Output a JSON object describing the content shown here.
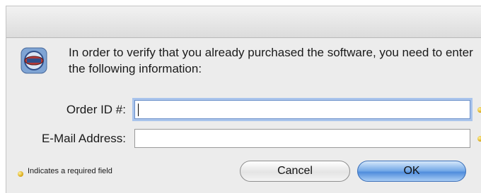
{
  "dialog": {
    "message": "In order to verify that you already purchased the software, you need to enter the following information:",
    "fields": {
      "order_id": {
        "label": "Order ID #:",
        "value": ""
      },
      "email": {
        "label": "E-Mail Address:",
        "value": ""
      }
    },
    "required_legend": "Indicates a required field",
    "buttons": {
      "cancel": "Cancel",
      "ok": "OK"
    }
  },
  "colors": {
    "default_button": "#5b95e0",
    "required_marker": "#d8a410",
    "focus_ring": "#a9c4ec"
  },
  "icons": {
    "app": "app-badge-icon",
    "required": "required-dot-icon"
  }
}
